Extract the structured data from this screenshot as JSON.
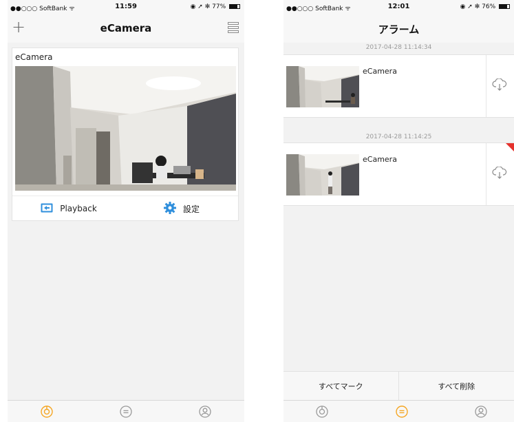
{
  "left": {
    "status": {
      "carrier": "●●○○○ SoftBank ᯤ",
      "time": "11:59",
      "right": "◉ ➚ ✻ 77%",
      "battery": 0.77
    },
    "nav_title": "eCamera",
    "camera_card": {
      "title": "eCamera",
      "playback_label": "Playback",
      "settings_label": "設定"
    }
  },
  "right": {
    "status": {
      "carrier": "●●○○○ SoftBank ᯤ",
      "time": "12:01",
      "right": "◉ ➚ ✻ 76%",
      "battery": 0.76
    },
    "nav_title": "アラーム",
    "alarms": [
      {
        "timestamp": "2017-04-28 11:14:34",
        "name": "eCamera",
        "unread": false
      },
      {
        "timestamp": "2017-04-28 11:14:25",
        "name": "eCamera",
        "unread": true
      }
    ],
    "mark_all_label": "すべてマーク",
    "delete_all_label": "すべて削除"
  },
  "colors": {
    "accent": "#f5a623",
    "link_blue": "#2f8fdc",
    "unread_flag": "#e5322d"
  },
  "tabs": [
    "camera-tab-icon",
    "message-tab-icon",
    "profile-tab-icon"
  ]
}
